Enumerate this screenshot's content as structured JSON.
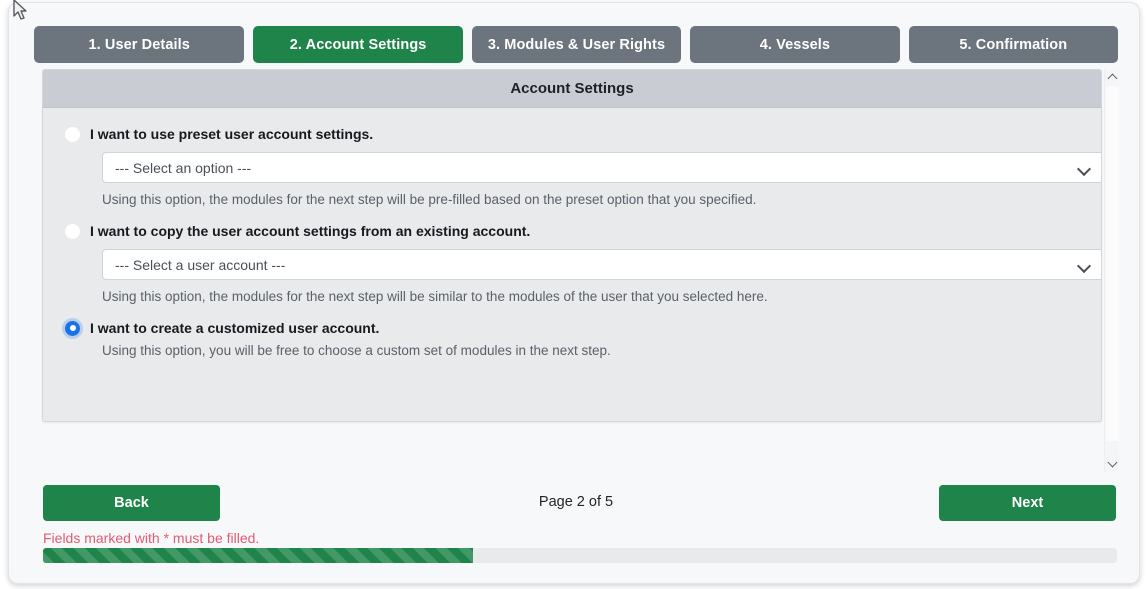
{
  "wizard": {
    "steps": [
      {
        "label": "1. User Details",
        "active": false
      },
      {
        "label": "2. Account Settings",
        "active": true
      },
      {
        "label": "3. Modules & User Rights",
        "active": false
      },
      {
        "label": "4. Vessels",
        "active": false
      },
      {
        "label": "5. Confirmation",
        "active": false
      }
    ],
    "accent_color": "#1e8449",
    "inactive_color": "#6c757d"
  },
  "panel": {
    "title": "Account Settings",
    "options": [
      {
        "label": "I want to use preset user account settings.",
        "selected": false,
        "select_value": "--- Select an option ---",
        "hint": "Using this option, the modules for the next step will be pre-filled based on the preset option that you specified."
      },
      {
        "label": "I want to copy the user account settings from an existing account.",
        "selected": false,
        "select_value": "--- Select a user account ---",
        "hint": "Using this option, the modules for the next step will be similar to the modules of the user that you selected here."
      },
      {
        "label": "I want to create a customized user account.",
        "selected": true,
        "hint": "Using this option, you will be free to choose a custom set of modules in the next step."
      }
    ]
  },
  "footer": {
    "back_label": "Back",
    "next_label": "Next",
    "page_indicator": "Page 2 of 5",
    "validation_message": "Fields marked with * must be filled.",
    "progress_percent": 40,
    "progress_color": "#1e8449",
    "validation_color": "#e05c72"
  },
  "scrollbar": {
    "up_icon": "chevron-up-icon",
    "down_icon": "chevron-down-icon"
  }
}
